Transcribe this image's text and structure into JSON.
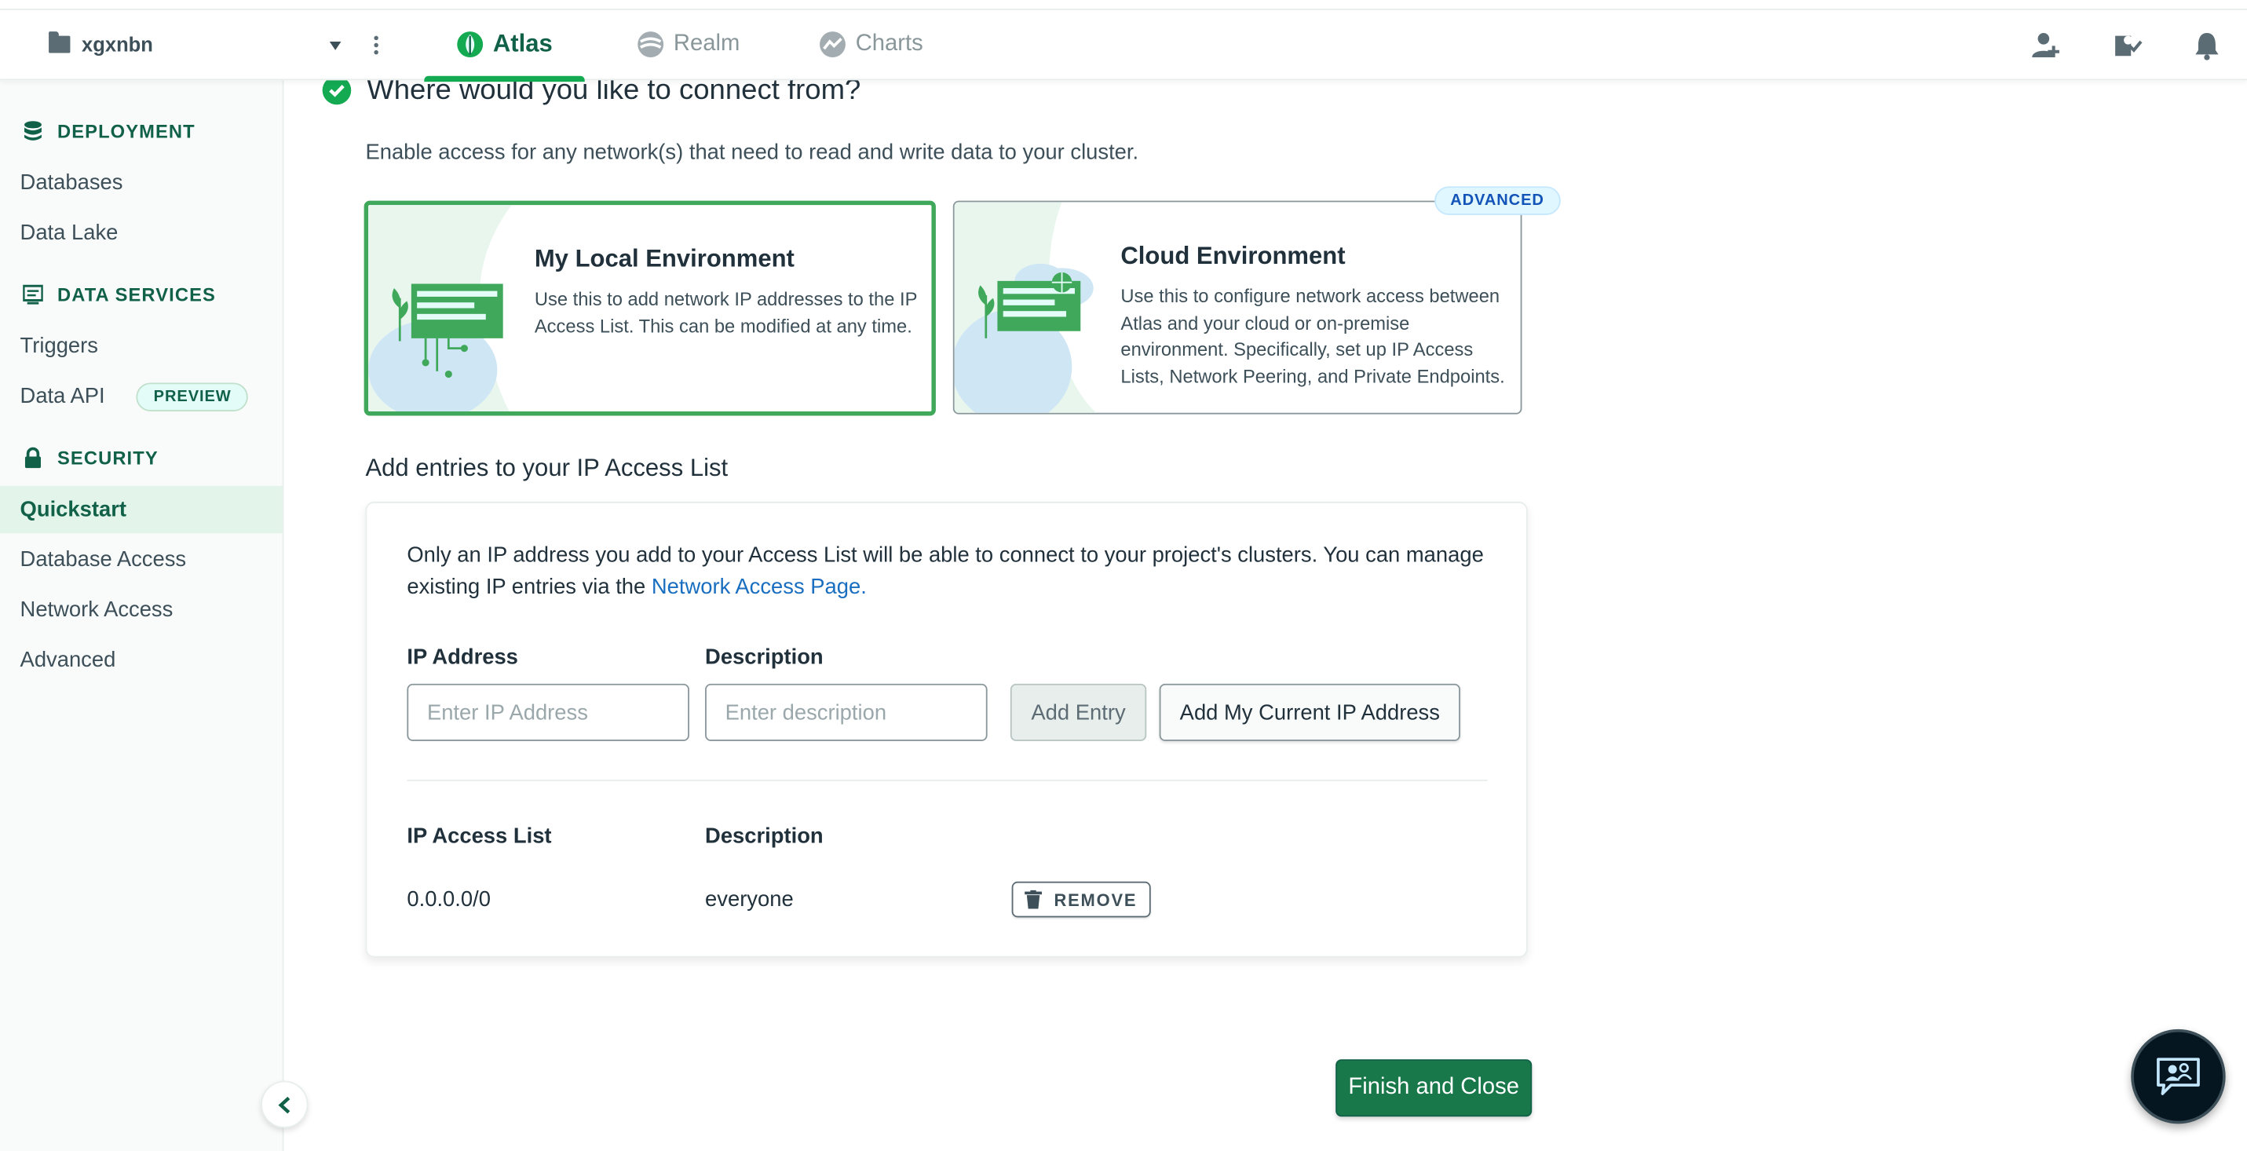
{
  "header": {
    "org_name": "xgxnbn",
    "tabs": [
      {
        "label": "Atlas",
        "icon": "atlas-leaf-icon"
      },
      {
        "label": "Realm",
        "icon": "realm-icon"
      },
      {
        "label": "Charts",
        "icon": "charts-icon"
      }
    ],
    "right_icons": [
      "invite-user-icon",
      "activity-feed-icon",
      "notifications-bell-icon"
    ]
  },
  "sidebar": {
    "sections": [
      {
        "heading": "DEPLOYMENT",
        "icon": "database-stack-icon",
        "items": [
          "Databases",
          "Data Lake"
        ]
      },
      {
        "heading": "DATA SERVICES",
        "icon": "data-services-icon",
        "items": [
          "Triggers",
          "Data API"
        ]
      },
      {
        "heading": "SECURITY",
        "icon": "lock-icon",
        "items": [
          "Quickstart",
          "Database Access",
          "Network Access",
          "Advanced"
        ]
      }
    ],
    "preview_badge": "PREVIEW",
    "active_item": "Quickstart"
  },
  "connect": {
    "title": "Where would you like to connect from?",
    "subtitle": "Enable access for any network(s) that need to read and write data to your cluster.",
    "local": {
      "title": "My Local Environment",
      "desc_line1": "Use this to add network IP addresses to the IP",
      "desc_line2": "Access List. This can be modified at any time."
    },
    "cloud": {
      "badge": "ADVANCED",
      "title": "Cloud Environment",
      "desc_line1": "Use this to configure network access between",
      "desc_line2": "Atlas and your cloud or on-premise",
      "desc_line3": "environment. Specifically, set up IP Access",
      "desc_line4": "Lists, Network Peering, and Private Endpoints."
    }
  },
  "ip_access": {
    "heading": "Add entries to your IP Access List",
    "info_text": "Only an IP address you add to your Access List will be able to connect to your project's clusters. You can manage existing IP entries via the ",
    "info_link": "Network Access Page.",
    "ip_label": "IP Address",
    "desc_label": "Description",
    "ip_placeholder": "Enter IP Address",
    "desc_placeholder": "Enter description",
    "add_entry": "Add Entry",
    "add_current": "Add My Current IP Address",
    "list_header_ip": "IP Access List",
    "list_header_desc": "Description",
    "entries": [
      {
        "ip": "0.0.0.0/0",
        "description": "everyone",
        "action": "REMOVE"
      }
    ]
  },
  "footer": {
    "finish": "Finish and Close"
  },
  "colors": {
    "brand_green": "#13aa52",
    "dark_green": "#116149",
    "link_blue": "#1a6ec0"
  }
}
